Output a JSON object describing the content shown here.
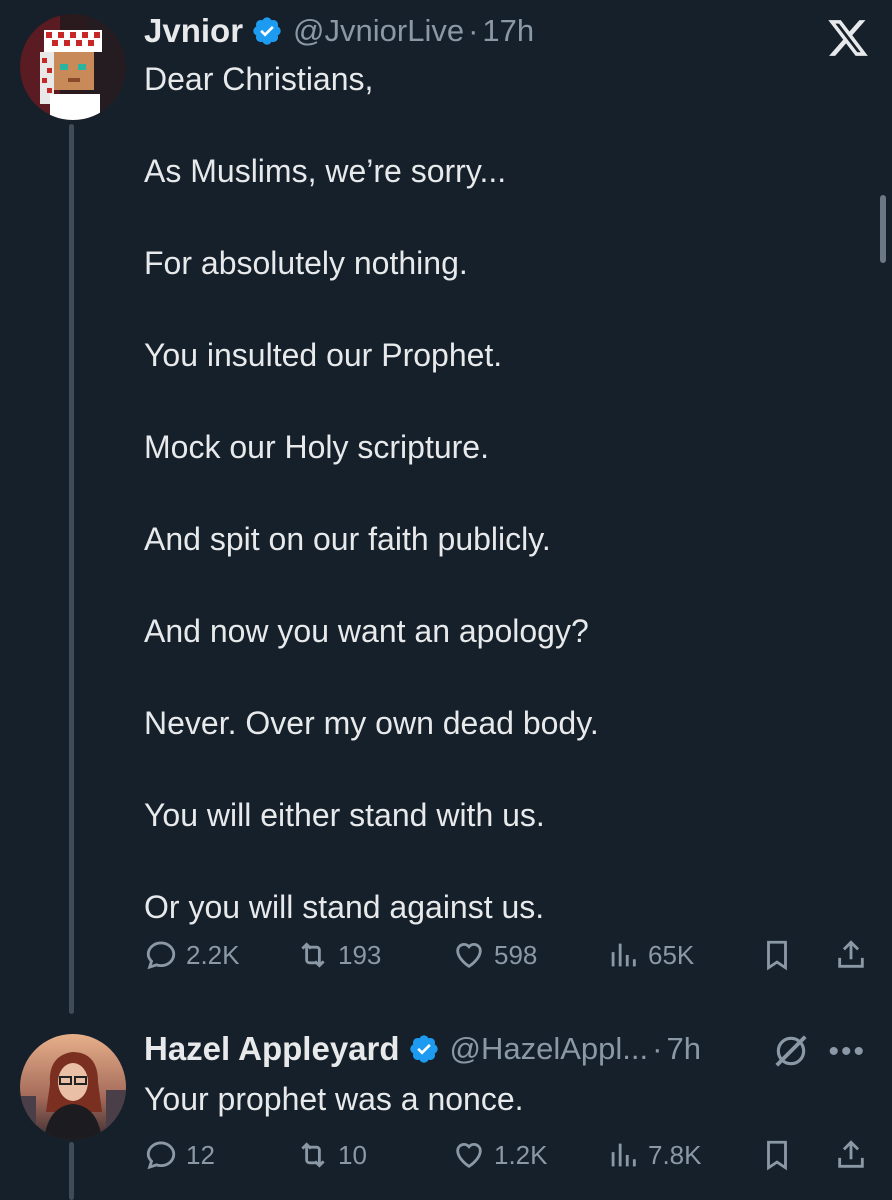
{
  "post": {
    "author_name": "Jvnior",
    "handle": "@JvniorLive",
    "separator": "·",
    "time": "17h",
    "lines": [
      "Dear Christians,",
      "",
      "As Muslims, we’re sorry...",
      "",
      "For absolutely nothing.",
      "",
      "You insulted our Prophet.",
      "",
      "Mock our Holy scripture.",
      "",
      "And spit on our faith publicly.",
      "",
      "And now you want an apology?",
      "",
      "Never. Over my own dead body.",
      "",
      "You will either stand with us.",
      "",
      "Or you will stand against us."
    ],
    "replies": "2.2K",
    "reposts": "193",
    "likes": "598",
    "views": "65K"
  },
  "reply": {
    "author_name": "Hazel Appleyard",
    "handle": "@HazelAppl...",
    "separator": "·",
    "time": "7h",
    "text": "Your prophet was a nonce.",
    "replies": "12",
    "reposts": "10",
    "likes": "1.2K",
    "views": "7.8K"
  },
  "colors": {
    "background": "#15202b",
    "text": "#e7e9ea",
    "muted": "#8b98a5",
    "verified": "#1d9bf0"
  },
  "icons": {
    "close": "x-logo-icon",
    "verified": "verified-badge-icon",
    "reply": "reply-icon",
    "repost": "repost-icon",
    "like": "heart-icon",
    "views": "views-icon",
    "bookmark": "bookmark-icon",
    "share": "share-icon",
    "grok": "grok-icon",
    "more": "more-icon"
  }
}
